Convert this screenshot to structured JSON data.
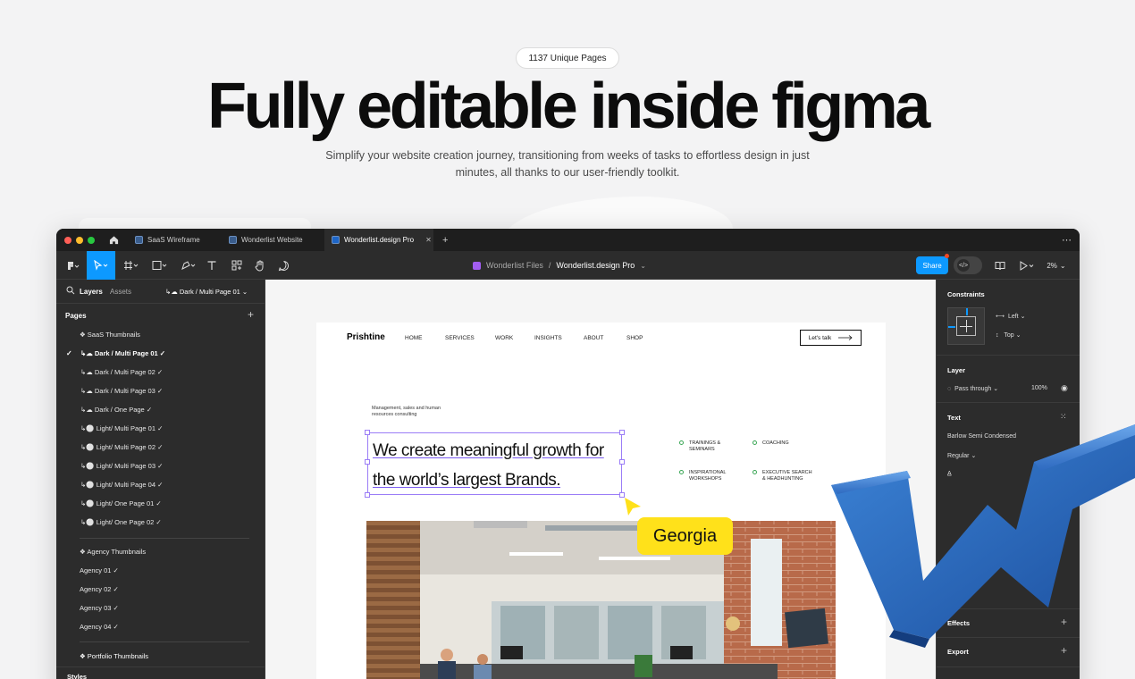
{
  "hero": {
    "badge": "1137 Unique Pages",
    "title": "Fully editable inside figma",
    "subtitle": "Simplify your website creation journey, transitioning from weeks of tasks to effortless design in just minutes, all thanks to our user-friendly toolkit."
  },
  "tabs": [
    {
      "label": "SaaS Wireframe"
    },
    {
      "label": "Wonderlist Website"
    },
    {
      "label": "Wonderlist.design Pro"
    }
  ],
  "toolbar": {
    "breadcrumb_folder": "Wonderlist Files",
    "breadcrumb_separator": "/",
    "breadcrumb_file": "Wonderlist.design Pro",
    "share": "Share",
    "zoom": "2%"
  },
  "left_panel": {
    "tab_layers": "Layers",
    "tab_assets": "Assets",
    "current_page": "Dark / Multi Page 01",
    "pages_title": "Pages",
    "pages": [
      {
        "label": "❖ SaaS Thumbnails",
        "bold": false,
        "check": false
      },
      {
        "label": "↳☁ Dark / Multi Page 01 ✓",
        "bold": true,
        "check": true
      },
      {
        "label": "↳☁ Dark / Multi Page 02 ✓",
        "bold": false,
        "check": false
      },
      {
        "label": "↳☁ Dark / Multi Page 03 ✓",
        "bold": false,
        "check": false
      },
      {
        "label": "↳☁ Dark / One Page ✓",
        "bold": false,
        "check": false
      },
      {
        "label": "↳⚪ Light/ Multi Page 01 ✓",
        "bold": false,
        "check": false
      },
      {
        "label": "↳⚪ Light/ Multi Page 02 ✓",
        "bold": false,
        "check": false
      },
      {
        "label": "↳⚪ Light/ Multi Page 03 ✓",
        "bold": false,
        "check": false
      },
      {
        "label": "↳⚪ Light/ Multi Page 04 ✓",
        "bold": false,
        "check": false
      },
      {
        "label": "↳⚪ Light/ One Page 01 ✓",
        "bold": false,
        "check": false
      },
      {
        "label": "↳⚪ Light/ One Page 02 ✓",
        "bold": false,
        "check": false
      }
    ],
    "pages2": [
      {
        "label": "❖ Agency Thumbnails"
      },
      {
        "label": "Agency 01 ✓"
      },
      {
        "label": "Agency 02 ✓"
      },
      {
        "label": "Agency 03 ✓"
      },
      {
        "label": "Agency 04 ✓"
      }
    ],
    "portfolio": "❖ Portfolio Thumbnails",
    "styles": "Styles"
  },
  "site": {
    "logo": "Prishtine",
    "nav": [
      "HOME",
      "SERVICES",
      "WORK",
      "INSIGHTS",
      "ABOUT",
      "SHOP"
    ],
    "cta": "Let's talk",
    "intro": "Management, sales and human resources consulting",
    "headline_1": "We create meaningful growth for",
    "headline_2": "the world’s largest Brands.",
    "services": [
      "TRAININGS & SEMINARS",
      "COACHING",
      "INSPIRATIONAL WORKSHOPS",
      "EXECUTIVE SEARCH & HEADHUNTING"
    ]
  },
  "cursor_label": "Georgia",
  "right_panel": {
    "constraints": "Constraints",
    "h_constraint": "Left",
    "v_constraint": "Top",
    "layer": "Layer",
    "blend": "Pass through",
    "opacity": "100%",
    "text": "Text",
    "font": "Barlow Semi Condensed",
    "weight": "Regular",
    "effects": "Effects",
    "export": "Export"
  },
  "colors": {
    "accent": "#0d99ff",
    "selection": "#9b7df7",
    "cursor": "#ffe11a",
    "logo_blue": "#2f6fc4"
  }
}
